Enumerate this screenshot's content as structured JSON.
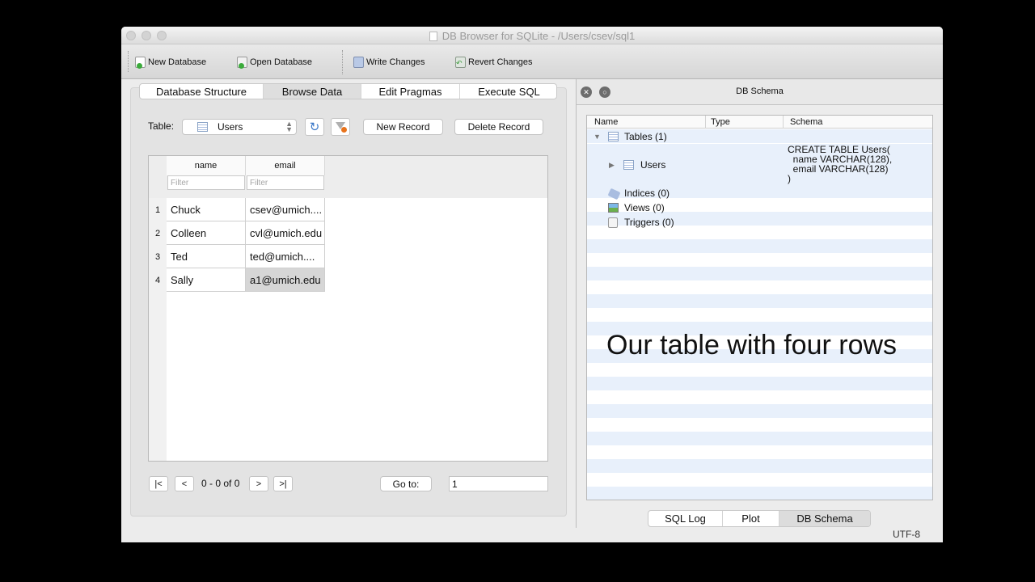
{
  "window": {
    "title": "DB Browser for SQLite - /Users/csev/sql1"
  },
  "toolbar": {
    "new_database": "New Database",
    "open_database": "Open Database",
    "write_changes": "Write Changes",
    "revert_changes": "Revert Changes"
  },
  "tabs": [
    "Database Structure",
    "Browse Data",
    "Edit Pragmas",
    "Execute SQL"
  ],
  "active_tab": "Browse Data",
  "browse": {
    "table_label": "Table:",
    "table_value": "Users",
    "new_record": "New Record",
    "delete_record": "Delete Record",
    "columns": [
      "name",
      "email"
    ],
    "filter_placeholder": "Filter",
    "rows": [
      {
        "num": "1",
        "name": "Chuck",
        "email": "csev@umich...."
      },
      {
        "num": "2",
        "name": "Colleen",
        "email": "cvl@umich.edu"
      },
      {
        "num": "3",
        "name": "Ted",
        "email": "ted@umich...."
      },
      {
        "num": "4",
        "name": "Sally",
        "email": "a1@umich.edu"
      }
    ],
    "nav": {
      "first": "|<",
      "prev": "<",
      "range": "0 - 0 of 0",
      "next": ">",
      "last": ">|"
    },
    "goto_label": "Go to:",
    "goto_value": "1"
  },
  "schema_panel": {
    "title": "DB Schema",
    "columns": [
      "Name",
      "Type",
      "Schema"
    ],
    "tables": "Tables (1)",
    "users": "Users",
    "users_schema": "CREATE TABLE Users(\n  name VARCHAR(128),\n  email VARCHAR(128)\n)",
    "indices": "Indices (0)",
    "views": "Views (0)",
    "triggers": "Triggers (0)"
  },
  "overlay_caption": "Our table with four rows",
  "bottom_tabs": [
    "SQL Log",
    "Plot",
    "DB Schema"
  ],
  "status": {
    "encoding": "UTF-8"
  },
  "colors": {
    "selected_cell": "#d6d6d6",
    "stripe": "#e8f0fb",
    "window_bg": "#ececec"
  }
}
